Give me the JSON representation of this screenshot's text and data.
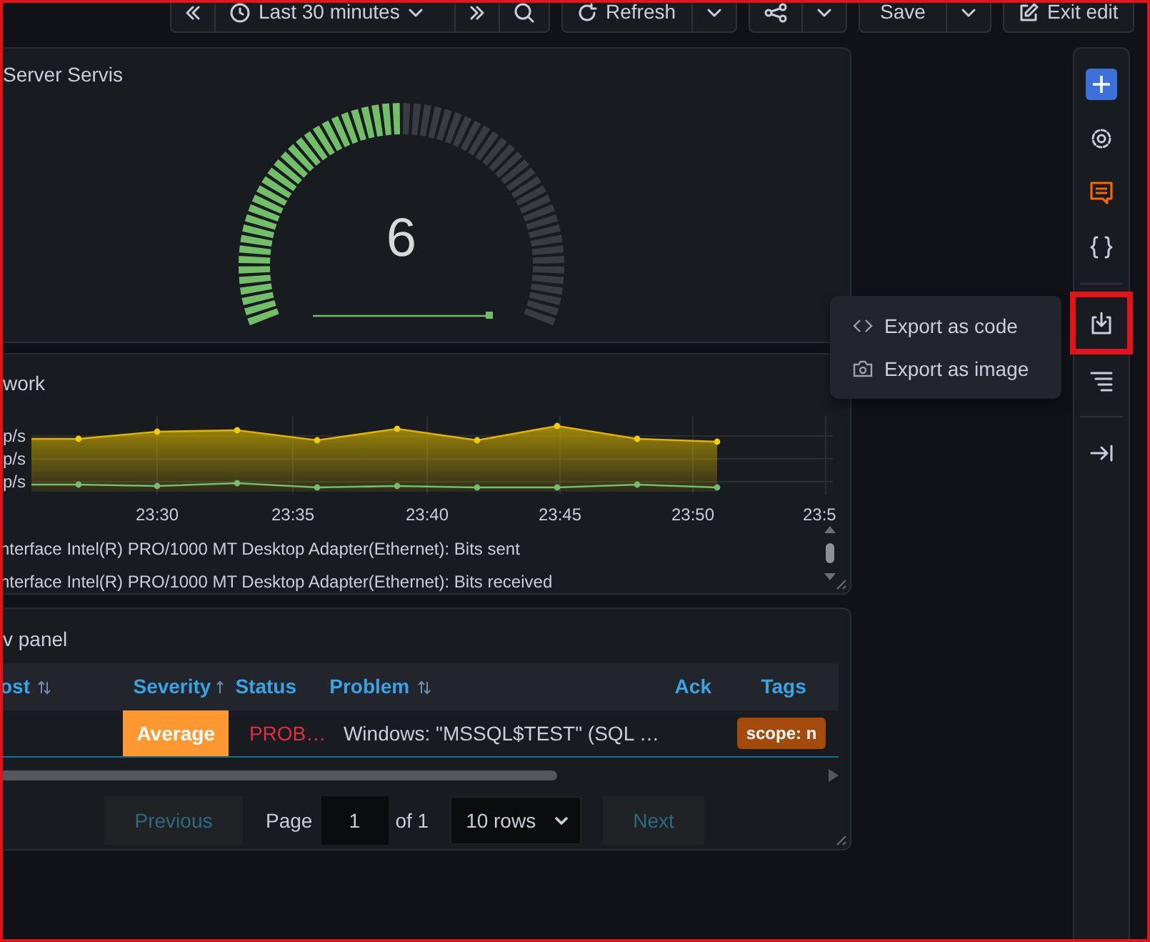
{
  "toolbar": {
    "time_range": "Last 30 minutes",
    "refresh": "Refresh",
    "save": "Save",
    "exit": "Exit edit"
  },
  "panels": [
    {
      "kind": "gauge",
      "title": "Server Servis",
      "value": "6"
    },
    {
      "kind": "timeseries",
      "title": "work",
      "y_labels": [
        "p/s",
        "p/s",
        "p/s"
      ],
      "x_labels": [
        "23:30",
        "23:35",
        "23:40",
        "23:45",
        "23:50",
        "23:5"
      ],
      "legend": [
        "nterface Intel(R) PRO/1000 MT Desktop Adapter(Ethernet): Bits sent",
        "nterface Intel(R) PRO/1000 MT Desktop Adapter(Ethernet): Bits received"
      ]
    },
    {
      "kind": "table",
      "title": "v panel",
      "columns": [
        {
          "label": "ost",
          "sortable": true,
          "sorted": false
        },
        {
          "label": "Severity",
          "sortable": true,
          "sorted": true
        },
        {
          "label": "Status",
          "sortable": false
        },
        {
          "label": "Problem",
          "sortable": true,
          "sorted": false
        },
        {
          "label": "Ack",
          "sortable": false
        },
        {
          "label": "Tags",
          "sortable": false
        }
      ],
      "rows": [
        {
          "severity": "Average",
          "status": "PROB…",
          "problem": "Windows: \"MSSQL$TEST\" (SQL …",
          "tags": [
            "scope: n"
          ]
        }
      ],
      "pagination": {
        "previous": {
          "label": "Previous",
          "disabled": true
        },
        "page_label": "Page",
        "page": "1",
        "of": "of 1",
        "rows": "10 rows",
        "next": {
          "label": "Next",
          "disabled": true
        }
      }
    }
  ],
  "sidebar": [
    {
      "kind": "add",
      "highlighted": false
    },
    {
      "kind": "settings",
      "highlighted": false
    },
    {
      "kind": "comment",
      "highlighted": false
    },
    {
      "kind": "code",
      "highlighted": false
    },
    {
      "kind": "divider"
    },
    {
      "kind": "export",
      "highlighted": true
    },
    {
      "kind": "outline",
      "highlighted": false
    },
    {
      "kind": "divider"
    },
    {
      "kind": "collapse",
      "highlighted": false
    }
  ],
  "menu": [
    {
      "kind": "code",
      "label": "Export as code"
    },
    {
      "kind": "image",
      "label": "Export as image"
    }
  ]
}
